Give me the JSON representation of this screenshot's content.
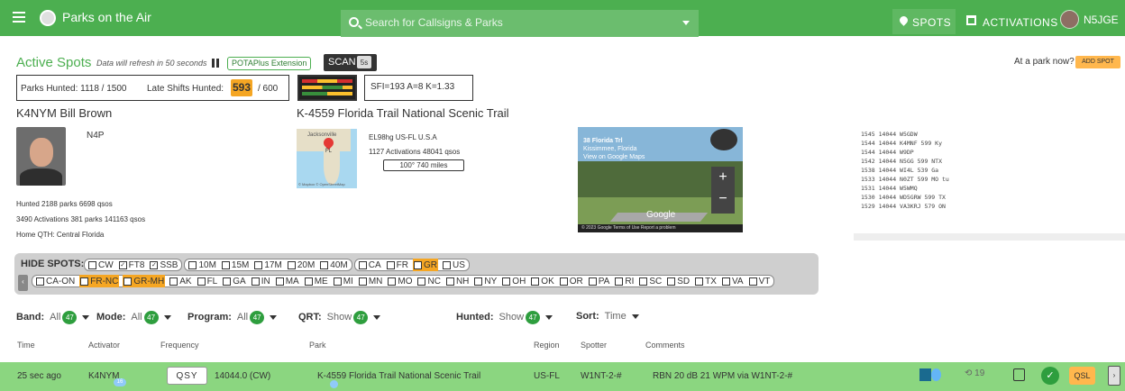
{
  "header": {
    "app_title": "Parks on the Air",
    "search_placeholder": "Search for Callsigns & Parks",
    "nav": [
      {
        "label": "SPOTS",
        "icon": "location-pin-icon"
      },
      {
        "label": "ACTIVATIONS",
        "icon": "calendar-icon"
      },
      {
        "label": "N5JGE",
        "icon": "user-avatar-icon"
      }
    ]
  },
  "status": {
    "title": "Active Spots",
    "refresh_text": "Data will refresh in 50 seconds",
    "extension_label": "POTAPlus Extension",
    "scan_label": "SCAN",
    "scan_seconds": "5s",
    "at_park_text": "At a park now?",
    "add_spot_label": "ADD SPOT",
    "parks_hunted": "Parks Hunted: 1118 / 1500",
    "late_shifts_label": "Late Shifts Hunted:",
    "late_shifts_value": "593",
    "late_shifts_total": "/ 600",
    "propagation": "SFI=193  A=8  K=1.33"
  },
  "activator": {
    "name": "K4NYM  Bill Brown",
    "alt_callsign": "N4P",
    "stats": [
      "Hunted 2188 parks 6698 qsos",
      "3490 Activations 381 parks 141163 qsos",
      "Home QTH: Central Florida"
    ]
  },
  "park": {
    "title": "K-4559 Florida Trail National Scenic Trail",
    "grid_location": "EL98hg US-FL U.S.A",
    "activations": "1127 Activations 48041 qsos",
    "bearing_distance": "100°   740 miles",
    "map_city": "Jacksonville",
    "map_state": "FL",
    "map_credit": "© Mapbox © OpenStreetMap",
    "streetview": {
      "place": "38 Florida Trl",
      "city": "Kissimmee, Florida",
      "link": "View on Google Maps",
      "brand": "Google",
      "footer": "© 2023 Google   Terms of Use   Report a problem"
    }
  },
  "spot_log": [
    "1545 14044 W5GDW",
    "1544 14044 K4MNF  599 Ky",
    "1544 14044 W9DP",
    "1542 14044 N5GG   599 NTX",
    "1538 14044 WI4L   539 Ga",
    "1533 14044 N0ZT   599 MO tu",
    "1531 14044 W5WMQ",
    "1530 14044 WD5GRW 599 TX",
    "1529 14044 VA3KRJ 579 ON"
  ],
  "hide_spots": {
    "label": "HIDE SPOTS:",
    "row1": [
      [
        {
          "t": "CW",
          "c": false
        },
        {
          "t": "FT8",
          "c": true
        },
        {
          "t": "SSB",
          "c": true
        }
      ],
      [
        {
          "t": "10M",
          "c": false
        },
        {
          "t": "15M",
          "c": false
        },
        {
          "t": "17M",
          "c": false
        },
        {
          "t": "20M",
          "c": false
        },
        {
          "t": "40M",
          "c": false
        }
      ],
      [
        {
          "t": "CA",
          "c": false
        },
        {
          "t": "FR",
          "c": false
        },
        {
          "t": "GR",
          "c": false,
          "active": true
        },
        {
          "t": "US",
          "c": false
        }
      ]
    ],
    "row2": [
      {
        "t": "CA-ON"
      },
      {
        "t": "FR-NC",
        "active": true
      },
      {
        "t": "GR-MH",
        "active": true
      },
      {
        "t": "AK"
      },
      {
        "t": "FL"
      },
      {
        "t": "GA"
      },
      {
        "t": "IN"
      },
      {
        "t": "MA"
      },
      {
        "t": "ME"
      },
      {
        "t": "MI"
      },
      {
        "t": "MN"
      },
      {
        "t": "MO"
      },
      {
        "t": "NC"
      },
      {
        "t": "NH"
      },
      {
        "t": "NY"
      },
      {
        "t": "OH"
      },
      {
        "t": "OK"
      },
      {
        "t": "OR"
      },
      {
        "t": "PA"
      },
      {
        "t": "RI"
      },
      {
        "t": "SC"
      },
      {
        "t": "SD"
      },
      {
        "t": "TX"
      },
      {
        "t": "VA"
      },
      {
        "t": "VT"
      }
    ]
  },
  "filters": {
    "band": {
      "label": "Band:",
      "value": "All",
      "count": "47"
    },
    "mode": {
      "label": "Mode:",
      "value": "All",
      "count": "47"
    },
    "program": {
      "label": "Program:",
      "value": "All",
      "count": "47"
    },
    "qrt": {
      "label": "QRT:",
      "value": "Show",
      "count": "47"
    },
    "hunted": {
      "label": "Hunted:",
      "value": "Show",
      "count": "47"
    },
    "sort": {
      "label": "Sort:",
      "value": "Time"
    }
  },
  "table": {
    "columns": [
      "Time",
      "Activator",
      "Frequency",
      "Park",
      "Region",
      "Spotter",
      "Comments"
    ],
    "rows": [
      {
        "time": "25 sec ago",
        "activator": "K4NYM",
        "activator_badge": "16",
        "qsy_label": "QSY",
        "frequency": "14044.0 (CW)",
        "park": "K-4559  Florida Trail National Scenic Trail",
        "region": "US-FL",
        "spotter": "W1NT-2-#",
        "comments": "RBN 20 dB 21 WPM via W1NT-2-#",
        "history_count": "19",
        "qsl_label": "QSL"
      }
    ]
  },
  "colors": {
    "brand": "#4caf50",
    "accent": "#f5a623",
    "row": "#8bd680"
  }
}
